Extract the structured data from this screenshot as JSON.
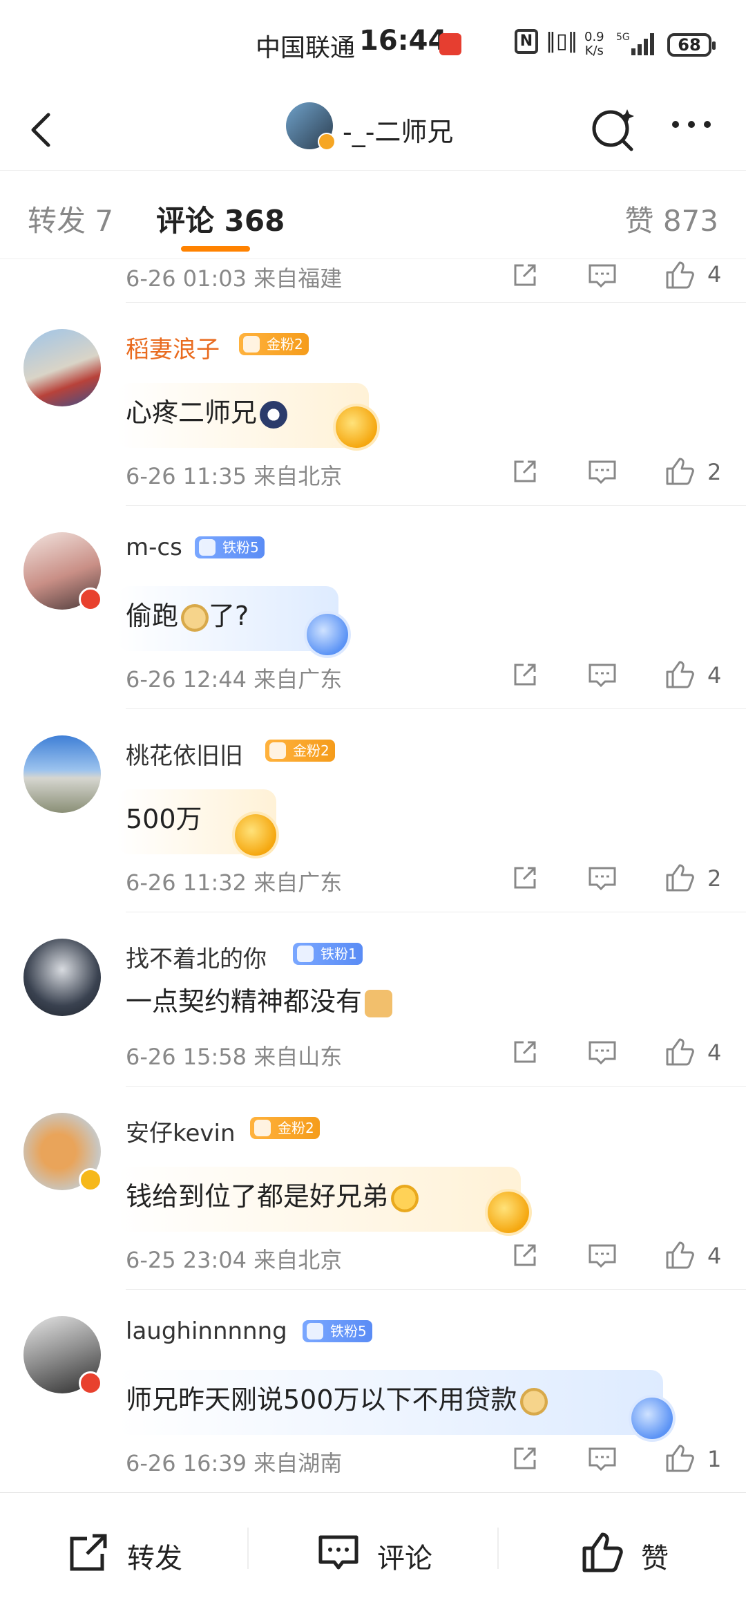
{
  "status": {
    "carrier": "中国联通",
    "time": "16:44",
    "speed_top": "0.9",
    "speed_bottom": "K/s",
    "network": "5G",
    "battery": "68"
  },
  "nav": {
    "title": "-_-二师兄"
  },
  "tabs": {
    "repost": "转发 7",
    "comment": "评论 368",
    "like": "赞 873"
  },
  "top_partial": {
    "meta": "6-26 01:03 来自福建",
    "likes": "4"
  },
  "comments": [
    {
      "name": "稻妻浪子",
      "fan": "金粉2",
      "text": "心疼二师兄",
      "meta": "6-26 11:35 来自北京",
      "likes": "2"
    },
    {
      "name": "m-cs",
      "fan": "铁粉5",
      "text": "偷跑",
      "text2": "了?",
      "meta": "6-26 12:44 来自广东",
      "likes": "4"
    },
    {
      "name": "桃花依旧旧",
      "fan": "金粉2",
      "text": "500万",
      "meta": "6-26 11:32 来自广东",
      "likes": "2"
    },
    {
      "name": "找不着北的你",
      "fan": "铁粉1",
      "text": "一点契约精神都没有",
      "meta": "6-26 15:58 来自山东",
      "likes": "4"
    },
    {
      "name": "安仔kevin",
      "fan": "金粉2",
      "text": "钱给到位了都是好兄弟",
      "meta": "6-25 23:04 来自北京",
      "likes": "4"
    },
    {
      "name": "laughinnnnng",
      "fan": "铁粉5",
      "text": "师兄昨天刚说500万以下不用贷款",
      "meta": "6-26 16:39 来自湖南",
      "likes": "1"
    }
  ],
  "bottom": {
    "repost": "转发",
    "comment": "评论",
    "like": "赞"
  },
  "colors": {
    "accent": "#ff8200",
    "gold_name": "#e96b1f",
    "gold_badge": "#f59c1b",
    "iron_badge": "#5a8cf5"
  }
}
